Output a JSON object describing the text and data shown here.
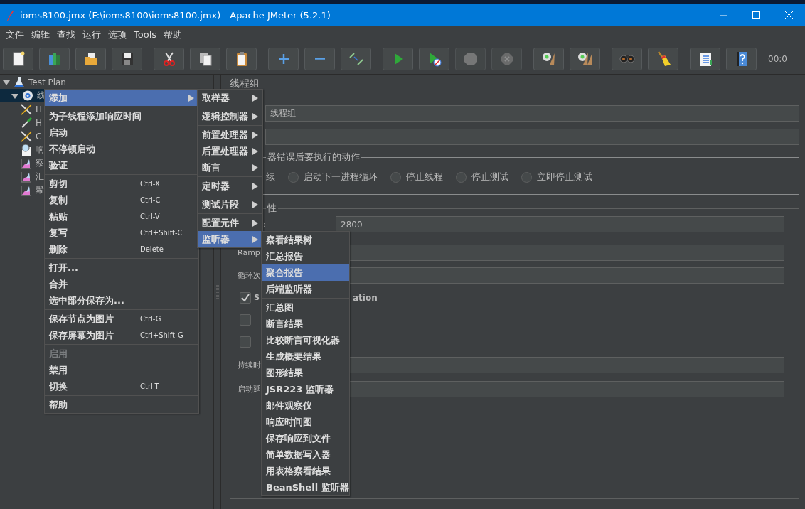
{
  "window": {
    "title": "ioms8100.jmx (F:\\ioms8100\\ioms8100.jmx) - Apache JMeter (5.2.1)"
  },
  "menu_bar": [
    {
      "label": "文件"
    },
    {
      "label": "编辑"
    },
    {
      "label": "查找"
    },
    {
      "label": "运行"
    },
    {
      "label": "选项"
    },
    {
      "label": "Tools"
    },
    {
      "label": "帮助"
    }
  ],
  "toolbar": {
    "groups": [
      {
        "buttons": [
          {
            "kind": "new",
            "disabled": false
          },
          {
            "kind": "templates",
            "disabled": false
          },
          {
            "kind": "open",
            "disabled": false
          },
          {
            "kind": "save",
            "disabled": false
          }
        ]
      },
      {
        "buttons": [
          {
            "kind": "cut",
            "disabled": false
          },
          {
            "kind": "copy",
            "disabled": false
          },
          {
            "kind": "paste",
            "disabled": false
          }
        ]
      },
      {
        "buttons": [
          {
            "kind": "expand",
            "disabled": false
          },
          {
            "kind": "collapse",
            "disabled": false
          },
          {
            "kind": "toggle",
            "disabled": false
          }
        ]
      },
      {
        "buttons": [
          {
            "kind": "start",
            "disabled": false
          },
          {
            "kind": "nopause",
            "disabled": false
          },
          {
            "kind": "stop",
            "disabled": true
          },
          {
            "kind": "shutdown",
            "disabled": true
          }
        ]
      },
      {
        "buttons": [
          {
            "kind": "clear",
            "disabled": false
          },
          {
            "kind": "clearall",
            "disabled": false
          }
        ]
      },
      {
        "buttons": [
          {
            "kind": "search",
            "disabled": false
          },
          {
            "kind": "reset",
            "disabled": false
          }
        ]
      },
      {
        "buttons": [
          {
            "kind": "functions",
            "disabled": false
          },
          {
            "kind": "help",
            "disabled": false
          }
        ]
      }
    ],
    "timer": "00:0"
  },
  "tree": [
    {
      "label": "Test Plan",
      "kind": "plan",
      "expanded": true,
      "selected": false,
      "children": [
        {
          "label": "线",
          "kind": "group",
          "expanded": true,
          "selected": true,
          "children": [
            {
              "label": "H",
              "kind": "tools",
              "selected": false
            },
            {
              "label": "H",
              "kind": "dropper",
              "selected": false
            },
            {
              "label": "C",
              "kind": "tools",
              "selected": false
            },
            {
              "label": "响",
              "kind": "magnifier",
              "selected": false
            },
            {
              "label": "察",
              "kind": "chart",
              "selected": false
            },
            {
              "label": "汇",
              "kind": "chart",
              "selected": false
            },
            {
              "label": "聚",
              "kind": "chart",
              "selected": false
            }
          ]
        }
      ]
    }
  ],
  "editor": {
    "title": "线程组",
    "name_value": "线程组",
    "on_error": {
      "legend": "器错误后要执行的动作",
      "first_option": "续",
      "options": [
        {
          "label": "启动下一进程循环",
          "selected": false
        },
        {
          "label": "停止线程",
          "selected": false
        },
        {
          "label": "停止测试",
          "selected": false
        },
        {
          "label": "立即停止测试",
          "selected": false
        }
      ]
    },
    "thread_props": {
      "legend": "性",
      "fields": [
        {
          "label": ":",
          "value": "2800"
        },
        {
          "label": "Ramp"
        },
        {
          "label": "循环次"
        }
      ],
      "checkboxes": [
        {
          "checked": true,
          "label": "S",
          "label_tail": "ation"
        },
        {
          "checked": false
        },
        {
          "checked": false
        }
      ],
      "fields_2": [
        {
          "label": "持续时"
        },
        {
          "label": "启动延"
        }
      ]
    }
  },
  "context_menu": [
    {
      "kind": "item",
      "label": "添加",
      "submenu": true,
      "selected": true,
      "disabled": false
    },
    {
      "kind": "separator"
    },
    {
      "kind": "item",
      "label": "为子线程添加响应时间",
      "submenu": false,
      "selected": false,
      "disabled": false
    },
    {
      "kind": "item",
      "label": "启动",
      "submenu": false,
      "selected": false,
      "disabled": false
    },
    {
      "kind": "item",
      "label": "不停顿启动",
      "submenu": false,
      "selected": false,
      "disabled": false
    },
    {
      "kind": "item",
      "label": "验证",
      "submenu": false,
      "selected": false,
      "disabled": false
    },
    {
      "kind": "separator"
    },
    {
      "kind": "item",
      "label": "剪切",
      "shortcut": "Ctrl-X",
      "submenu": false,
      "selected": false,
      "disabled": false
    },
    {
      "kind": "item",
      "label": "复制",
      "shortcut": "Ctrl-C",
      "submenu": false,
      "selected": false,
      "disabled": false
    },
    {
      "kind": "item",
      "label": "粘贴",
      "shortcut": "Ctrl-V",
      "submenu": false,
      "selected": false,
      "disabled": false
    },
    {
      "kind": "item",
      "label": "复写",
      "shortcut": "Ctrl+Shift-C",
      "submenu": false,
      "selected": false,
      "disabled": false
    },
    {
      "kind": "item",
      "label": "删除",
      "shortcut": "Delete",
      "submenu": false,
      "selected": false,
      "disabled": false
    },
    {
      "kind": "separator"
    },
    {
      "kind": "item",
      "label": "打开...",
      "submenu": false,
      "selected": false,
      "disabled": false
    },
    {
      "kind": "item",
      "label": "合并",
      "submenu": false,
      "selected": false,
      "disabled": false
    },
    {
      "kind": "item",
      "label": "选中部分保存为...",
      "submenu": false,
      "selected": false,
      "disabled": false
    },
    {
      "kind": "separator"
    },
    {
      "kind": "item",
      "label": "保存节点为图片",
      "shortcut": "Ctrl-G",
      "submenu": false,
      "selected": false,
      "disabled": false
    },
    {
      "kind": "item",
      "label": "保存屏幕为图片",
      "shortcut": "Ctrl+Shift-G",
      "submenu": false,
      "selected": false,
      "disabled": false
    },
    {
      "kind": "separator"
    },
    {
      "kind": "item",
      "label": "启用",
      "submenu": false,
      "selected": false,
      "disabled": true
    },
    {
      "kind": "item",
      "label": "禁用",
      "submenu": false,
      "selected": false,
      "disabled": false
    },
    {
      "kind": "item",
      "label": "切换",
      "shortcut": "Ctrl-T",
      "submenu": false,
      "selected": false,
      "disabled": false
    },
    {
      "kind": "separator"
    },
    {
      "kind": "item",
      "label": "帮助",
      "submenu": false,
      "selected": false,
      "disabled": false
    }
  ],
  "add_submenu": [
    {
      "kind": "item",
      "label": "取样器",
      "submenu": true,
      "selected": false,
      "disabled": false
    },
    {
      "kind": "separator"
    },
    {
      "kind": "item",
      "label": "逻辑控制器",
      "submenu": true,
      "selected": false,
      "disabled": false
    },
    {
      "kind": "separator"
    },
    {
      "kind": "item",
      "label": "前置处理器",
      "submenu": true,
      "selected": false,
      "disabled": false
    },
    {
      "kind": "item",
      "label": "后置处理器",
      "submenu": true,
      "selected": false,
      "disabled": false
    },
    {
      "kind": "item",
      "label": "断言",
      "submenu": true,
      "selected": false,
      "disabled": false
    },
    {
      "kind": "separator"
    },
    {
      "kind": "item",
      "label": "定时器",
      "submenu": true,
      "selected": false,
      "disabled": false
    },
    {
      "kind": "separator"
    },
    {
      "kind": "item",
      "label": "测试片段",
      "submenu": true,
      "selected": false,
      "disabled": false
    },
    {
      "kind": "separator"
    },
    {
      "kind": "item",
      "label": "配置元件",
      "submenu": true,
      "selected": false,
      "disabled": false
    },
    {
      "kind": "item",
      "label": "监听器",
      "submenu": true,
      "selected": true,
      "disabled": false
    }
  ],
  "listener_submenu": [
    {
      "kind": "item",
      "label": "察看结果树",
      "selected": false,
      "disabled": false
    },
    {
      "kind": "item",
      "label": "汇总报告",
      "selected": false,
      "disabled": false
    },
    {
      "kind": "item",
      "label": "聚合报告",
      "selected": true,
      "disabled": false
    },
    {
      "kind": "item",
      "label": "后端监听器",
      "selected": false,
      "disabled": false
    },
    {
      "kind": "separator"
    },
    {
      "kind": "item",
      "label": "汇总图",
      "selected": false,
      "disabled": false
    },
    {
      "kind": "item",
      "label": "断言结果",
      "selected": false,
      "disabled": false
    },
    {
      "kind": "item",
      "label": "比较断言可视化器",
      "selected": false,
      "disabled": false
    },
    {
      "kind": "item",
      "label": "生成概要结果",
      "selected": false,
      "disabled": false
    },
    {
      "kind": "item",
      "label": "图形结果",
      "selected": false,
      "disabled": false
    },
    {
      "kind": "item",
      "label": "JSR223 监听器",
      "selected": false,
      "disabled": false
    },
    {
      "kind": "item",
      "label": "邮件观察仪",
      "selected": false,
      "disabled": false
    },
    {
      "kind": "item",
      "label": "响应时间图",
      "selected": false,
      "disabled": false
    },
    {
      "kind": "item",
      "label": "保存响应到文件",
      "selected": false,
      "disabled": false
    },
    {
      "kind": "item",
      "label": "简单数据写入器",
      "selected": false,
      "disabled": false
    },
    {
      "kind": "item",
      "label": "用表格察看结果",
      "selected": false,
      "disabled": false
    },
    {
      "kind": "item",
      "label": "BeanShell 监听器",
      "selected": false,
      "disabled": false
    }
  ]
}
